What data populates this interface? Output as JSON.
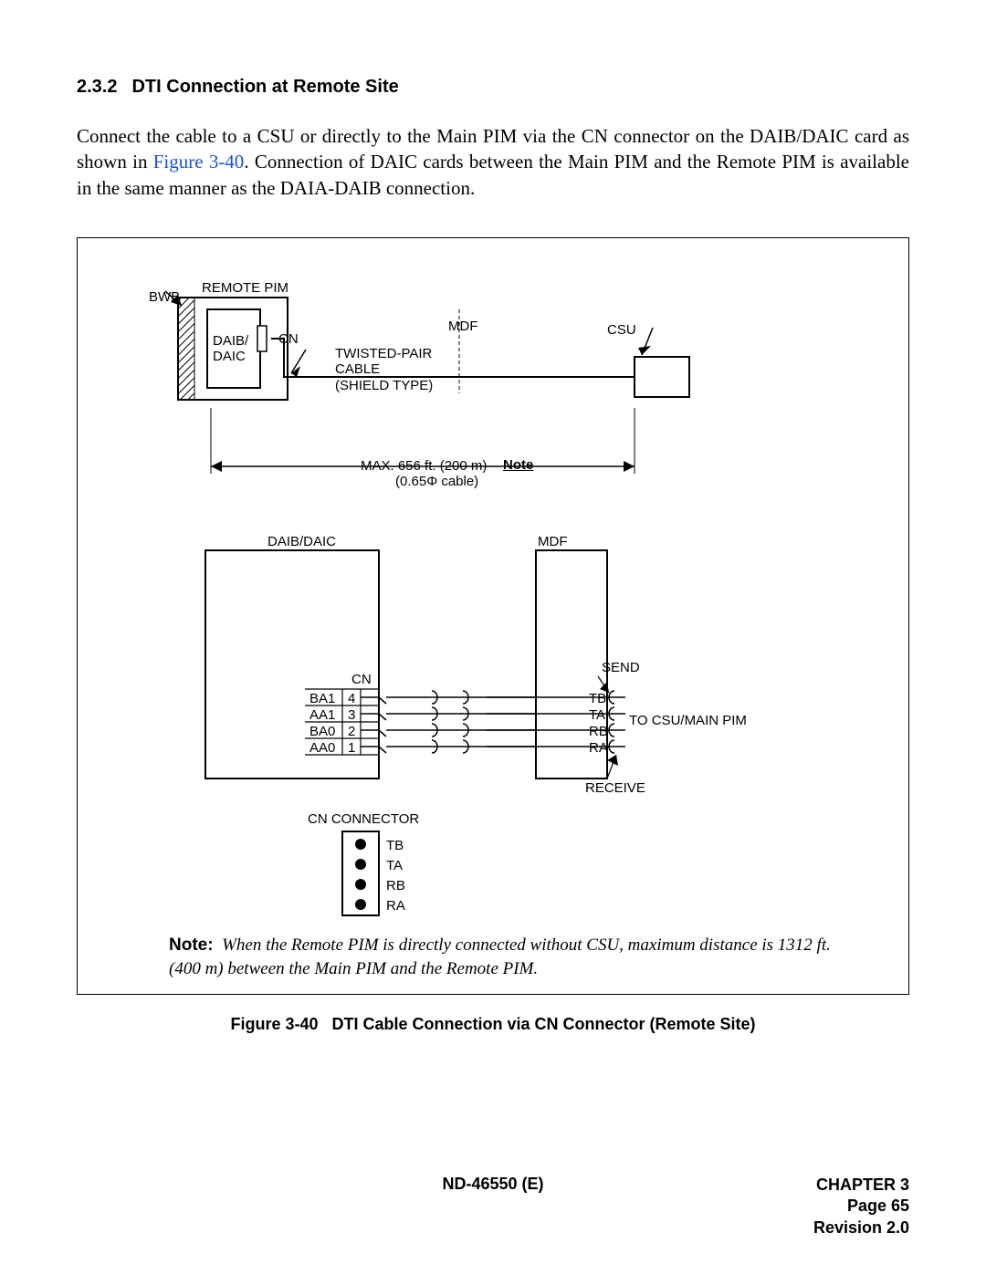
{
  "section": {
    "number": "2.3.2",
    "title": "DTI Connection at Remote Site"
  },
  "paragraph": {
    "t1": "Connect the cable to a CSU or directly to the Main PIM via the CN connector on the DAIB/DAIC card as shown in ",
    "link": "Figure 3-40",
    "t2": ". Connection of DAIC cards between the Main PIM and the Remote PIM is available in the same manner as the DAIA-DAIB connection."
  },
  "diagram": {
    "top": {
      "remote_pim": "REMOTE PIM",
      "bwb": "BWB",
      "daib_daic": "DAIB/\nDAIC",
      "cn": "CN",
      "twisted": "TWISTED-PAIR\nCABLE\n(SHIELD TYPE)",
      "mdf": "MDF",
      "csu": "CSU",
      "max": "MAX. 656 ft. (200 m)",
      "cable_spec": "(0.65Φ cable)",
      "note_ul": "Note"
    },
    "bottom": {
      "daib_daic": "DAIB/DAIC",
      "mdf": "MDF",
      "cn": "CN",
      "pins": {
        "ba1": "BA1",
        "aa1": "AA1",
        "ba0": "BA0",
        "aa0": "AA0",
        "n4": "4",
        "n3": "3",
        "n2": "2",
        "n1": "1"
      },
      "send": "SEND",
      "receive": "RECEIVE",
      "tb": "TB",
      "ta": "TA",
      "rb": "RB",
      "ra": "RA",
      "to_csu": "TO CSU/MAIN PIM",
      "cn_connector": "CN CONNECTOR",
      "conn": {
        "tb": "TB",
        "ta": "TA",
        "rb": "RB",
        "ra": "RA"
      }
    },
    "note": {
      "label": "Note:",
      "text": "When the Remote PIM is directly connected without CSU, maximum distance is 1312 ft. (400 m) between the Main PIM and the Remote PIM."
    }
  },
  "caption": {
    "label": "Figure 3-40",
    "text": "DTI Cable Connection via CN Connector (Remote Site)"
  },
  "footer": {
    "doc": "ND-46550 (E)",
    "chapter": "CHAPTER 3",
    "page": "Page 65",
    "revision": "Revision 2.0"
  }
}
